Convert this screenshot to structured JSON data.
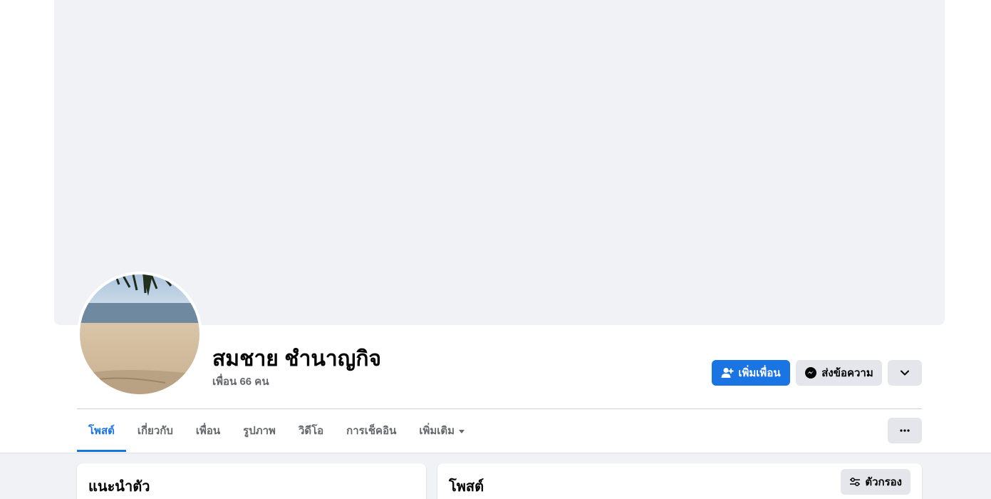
{
  "profile": {
    "name": "สมชาย ชำนาญกิจ",
    "friends_count": "เพื่อน 66 คน"
  },
  "actions": {
    "add_friend_label": "เพิ่มเพื่อน",
    "message_label": "ส่งข้อความ"
  },
  "tabs": [
    {
      "label": "โพสต์",
      "active": true
    },
    {
      "label": "เกี่ยวกับ",
      "active": false
    },
    {
      "label": "เพื่อน",
      "active": false
    },
    {
      "label": "รูปภาพ",
      "active": false
    },
    {
      "label": "วิดีโอ",
      "active": false
    },
    {
      "label": "การเช็คอิน",
      "active": false
    },
    {
      "label": "เพิ่มเติม",
      "active": false
    }
  ],
  "cards": {
    "intro_title": "แนะนำตัว",
    "posts_title": "โพสต์",
    "filter_label": "ตัวกรอง"
  },
  "colors": {
    "accent": "#1b74e4",
    "page_bg": "#f0f2f5",
    "secondary_button": "#e4e6eb",
    "muted_text": "#65676b"
  }
}
